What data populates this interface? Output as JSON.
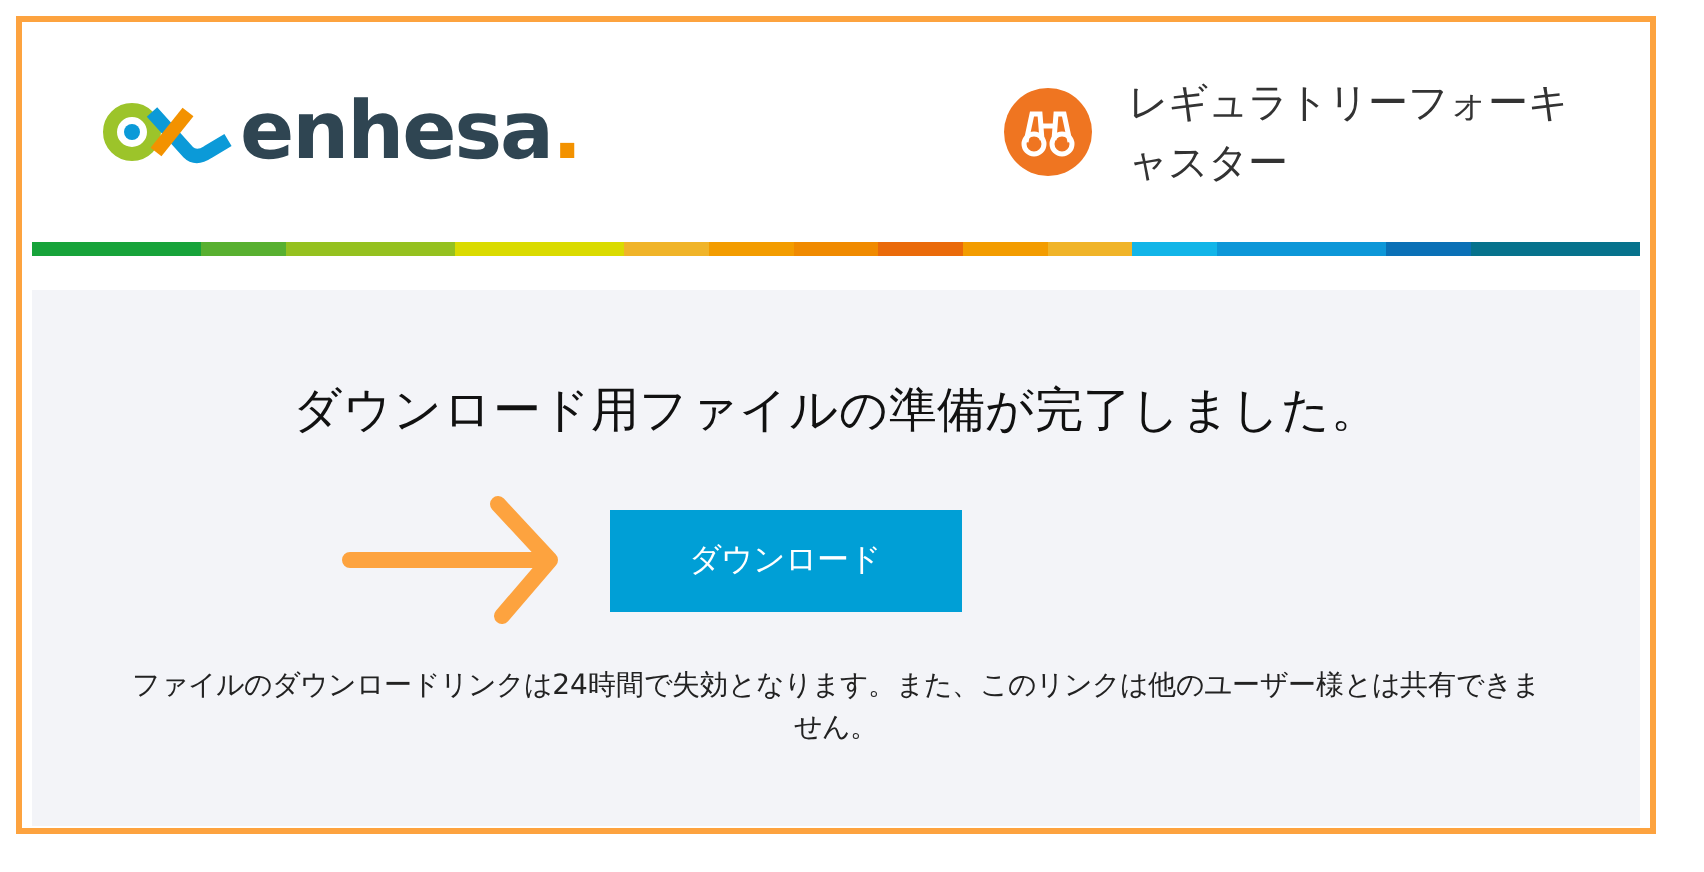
{
  "header": {
    "logo": {
      "name": "enhesa",
      "mark": "."
    },
    "product_title": "レギュラトリーフォーキャスター"
  },
  "panel": {
    "message": "ダウンロード用ファイルの準備が完了しました。",
    "button": "ダウンロード",
    "note": "ファイルのダウンロードリンクは24時間で失効となります。また、このリンクは他のユーザー様とは共有できません。"
  }
}
